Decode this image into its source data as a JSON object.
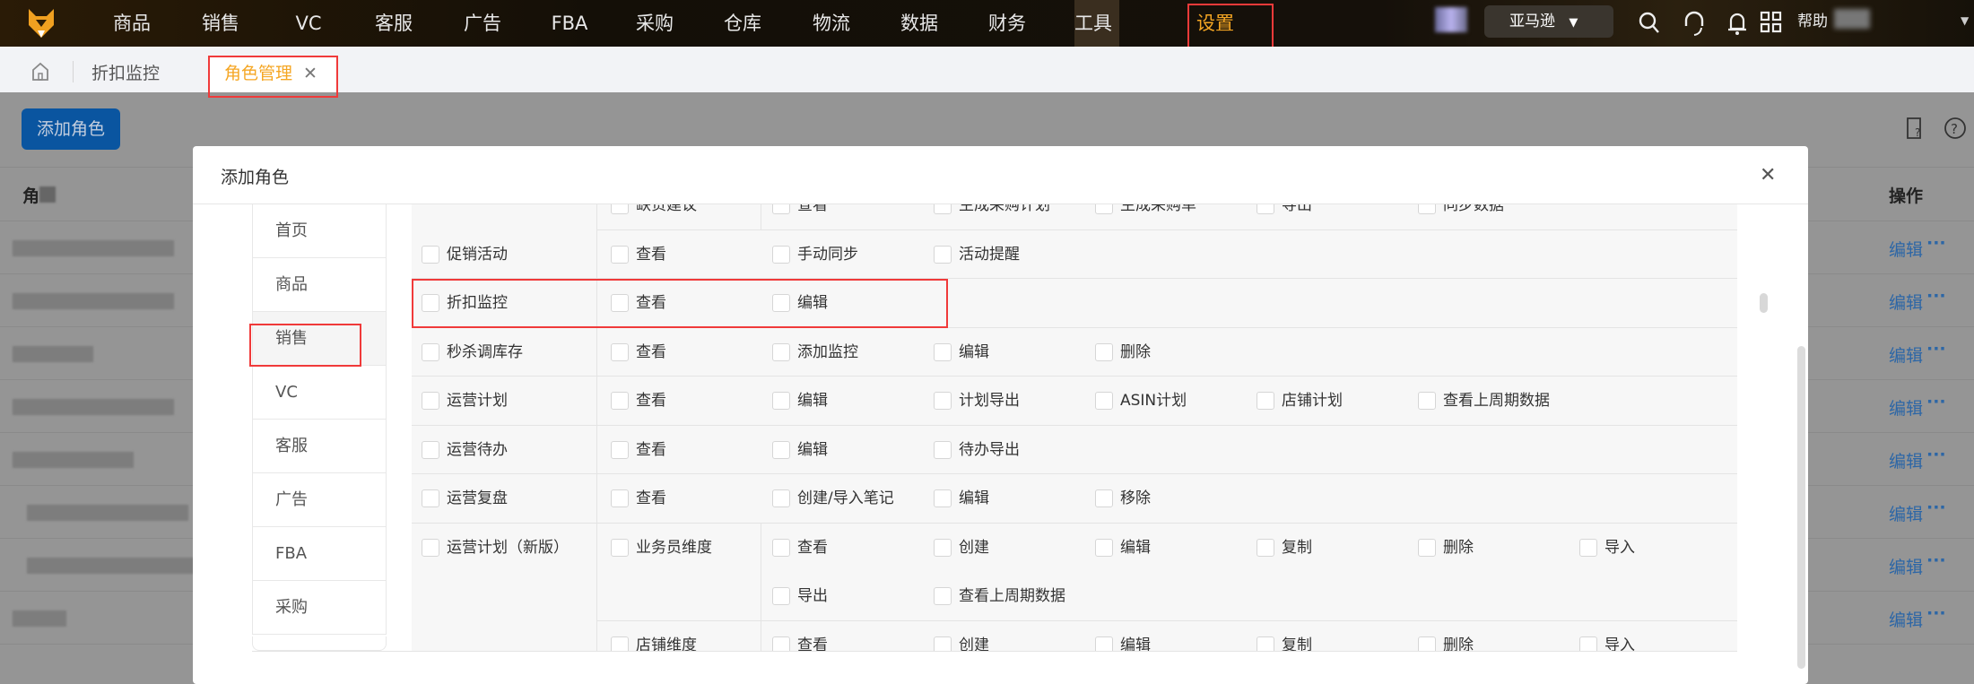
{
  "topnav": {
    "items": [
      "商品",
      "销售",
      "VC",
      "客服",
      "广告",
      "FBA",
      "采购",
      "仓库",
      "物流",
      "数据",
      "财务",
      "工具",
      "设置"
    ],
    "active": "设置",
    "platform": "亚马逊",
    "help": "帮助"
  },
  "tabs": {
    "items": [
      "折扣监控"
    ],
    "active": "角色管理"
  },
  "page": {
    "add_button": "添加角色",
    "col_role": "角",
    "col_action": "操作",
    "row_action": "编辑",
    "row_more": "···"
  },
  "modal": {
    "title": "添加角色",
    "menu": [
      "首页",
      "商品",
      "销售",
      "VC",
      "客服",
      "广告",
      "FBA",
      "采购"
    ],
    "selected_menu": "销售",
    "rows": [
      {
        "name": "",
        "subs": [
          {
            "name": "缺货建议",
            "options": [
              "查看",
              "生成采购计划",
              "生成采购单",
              "导出",
              "同步数据"
            ]
          }
        ]
      },
      {
        "name": "促销活动",
        "options": [
          "查看",
          "手动同步",
          "活动提醒"
        ]
      },
      {
        "name": "折扣监控",
        "options": [
          "查看",
          "编辑"
        ]
      },
      {
        "name": "秒杀调库存",
        "options": [
          "查看",
          "添加监控",
          "编辑",
          "删除"
        ]
      },
      {
        "name": "运营计划",
        "options": [
          "查看",
          "编辑",
          "计划导出",
          "ASIN计划",
          "店铺计划",
          "查看上周期数据"
        ]
      },
      {
        "name": "运营待办",
        "options": [
          "查看",
          "编辑",
          "待办导出"
        ]
      },
      {
        "name": "运营复盘",
        "options": [
          "查看",
          "创建/导入笔记",
          "编辑",
          "移除"
        ]
      },
      {
        "name": "运营计划（新版）",
        "subs": [
          {
            "name": "业务员维度",
            "options": [
              "查看",
              "创建",
              "编辑",
              "复制",
              "删除",
              "导入",
              "导出",
              "查看上周期数据"
            ]
          },
          {
            "name": "店铺维度",
            "options": [
              "查看",
              "创建",
              "编辑",
              "复制",
              "删除",
              "导入"
            ]
          }
        ]
      }
    ]
  },
  "colors": {
    "accent": "#f5a623",
    "primary": "#0a55a0",
    "highlight": "#f03a3a"
  }
}
